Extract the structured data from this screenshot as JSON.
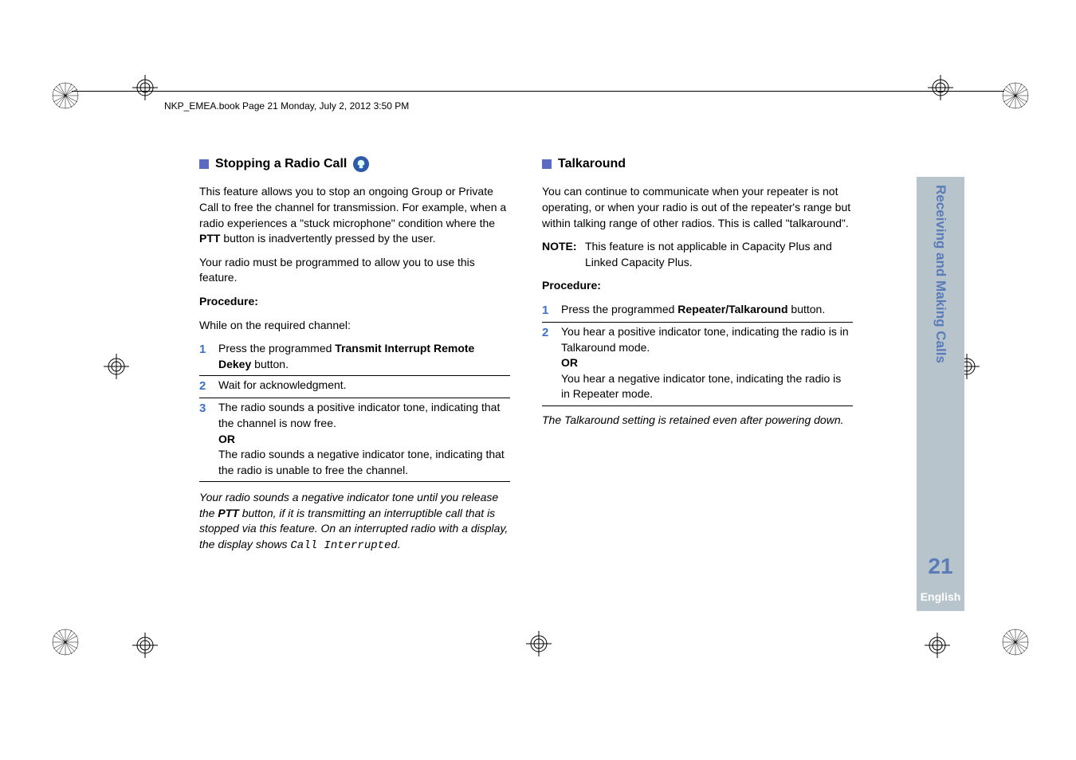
{
  "header": "NKP_EMEA.book  Page 21  Monday, July 2, 2012  3:50 PM",
  "left": {
    "title": "Stopping a Radio Call",
    "intro_part1": "This feature allows you to stop an ongoing Group or Private Call to free the channel for transmission. For example, when a radio experiences a \"stuck microphone\" condition where the ",
    "intro_bold1": "PTT",
    "intro_part2": " button is inadvertently pressed by the user.",
    "note": "Your radio must be programmed to allow you to use this feature.",
    "proc_label": "Procedure:",
    "proc_sub": "While on the required channel:",
    "step1_a": "Press the programmed ",
    "step1_b": "Transmit Interrupt Remote Dekey",
    "step1_c": " button.",
    "step2": "Wait for acknowledgment.",
    "step3_a": "The radio sounds a positive indicator tone, indicating that the channel is now free.",
    "step3_or": "OR",
    "step3_b": "The radio sounds a negative indicator tone, indicating that the radio is unable to free the channel.",
    "footer_a": "Your radio sounds a negative indicator tone until you release the ",
    "footer_bold": "PTT",
    "footer_b": " button, if it is transmitting an interruptible call that is stopped via this feature. On an interrupted radio with a display, the display shows ",
    "footer_code": "Call Interrupted",
    "footer_c": "."
  },
  "right": {
    "title": "Talkaround",
    "intro": "You can continue to communicate when your repeater is not operating, or when your radio is out of the repeater's range but within talking range of other radios. This is called \"talkaround\".",
    "note_label": "NOTE:",
    "note_text": "This feature is not applicable in Capacity Plus and Linked Capacity Plus.",
    "proc_label": "Procedure:",
    "step1_a": "Press the programmed ",
    "step1_b": "Repeater/Talkaround",
    "step1_c": " button.",
    "step2_a": "You hear a positive indicator tone, indicating the radio is in Talkaround mode.",
    "step2_or": "OR",
    "step2_b": "You hear a negative indicator tone, indicating the radio is in Repeater mode.",
    "footer": "The Talkaround setting is retained even after powering down."
  },
  "tab": {
    "title": "Receiving and Making Calls",
    "page": "21",
    "lang": "English"
  }
}
